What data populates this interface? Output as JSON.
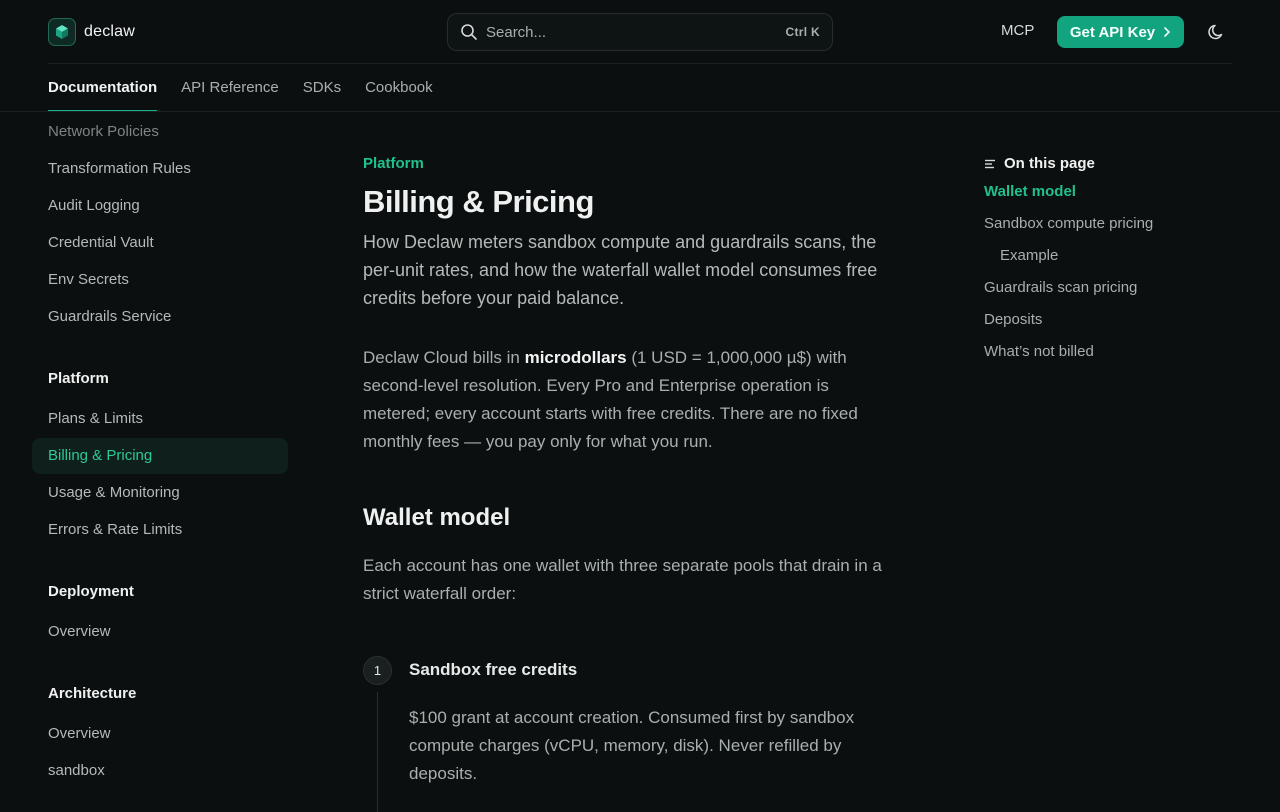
{
  "brand": {
    "name": "declaw"
  },
  "search": {
    "placeholder": "Search...",
    "shortcut": "Ctrl K"
  },
  "header": {
    "mcp_label": "MCP",
    "api_key_label": "Get API Key"
  },
  "tabs": [
    "Documentation",
    "API Reference",
    "SDKs",
    "Cookbook"
  ],
  "sidebar": {
    "items_top": [
      "Network Policies",
      "Transformation Rules",
      "Audit Logging",
      "Credential Vault",
      "Env Secrets",
      "Guardrails Service"
    ],
    "platform_heading": "Platform",
    "platform_items": [
      "Plans & Limits",
      "Billing & Pricing",
      "Usage & Monitoring",
      "Errors & Rate Limits"
    ],
    "deployment_heading": "Deployment",
    "deployment_items": [
      "Overview"
    ],
    "architecture_heading": "Architecture",
    "architecture_items": [
      "Overview",
      "sandbox"
    ]
  },
  "content": {
    "eyebrow": "Platform",
    "title": "Billing & Pricing",
    "lead": "How Declaw meters sandbox compute and guardrails scans, the per-unit rates, and how the waterfall wallet model consumes free credits before your paid balance.",
    "intro_prefix": "Declaw Cloud bills in ",
    "intro_bold": "microdollars",
    "intro_suffix": " (1 USD = 1,000,000 µ$) with second-level resolution. Every Pro and Enterprise operation is metered; every account starts with free credits. There are no fixed monthly fees — you pay only for what you run.",
    "wallet_heading": "Wallet model",
    "wallet_para": "Each account has one wallet with three separate pools that drain in a strict waterfall order:",
    "step_number": "1",
    "step_title": "Sandbox free credits",
    "step_body": "$100 grant at account creation. Consumed first by sandbox compute charges (vCPU, memory, disk). Never refilled by deposits."
  },
  "toc": {
    "heading": "On this page",
    "items": [
      "Wallet model",
      "Sandbox compute pricing",
      "Example",
      "Guardrails scan pricing",
      "Deposits",
      "What’s not billed"
    ]
  },
  "colors": {
    "accent": "#12a37f",
    "accent_text": "#20c08f",
    "background": "#0b0f0f"
  }
}
